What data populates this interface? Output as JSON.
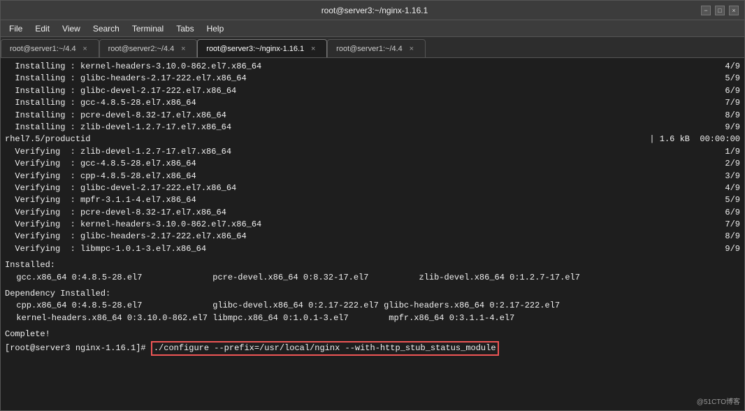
{
  "window": {
    "title": "root@server3:~/nginx-1.16.1",
    "controls": {
      "minimize": "−",
      "maximize": "□",
      "close": "×"
    }
  },
  "menubar": {
    "items": [
      "File",
      "Edit",
      "View",
      "Search",
      "Terminal",
      "Tabs",
      "Help"
    ]
  },
  "tabs": [
    {
      "id": "tab1",
      "label": "root@server1:~/4.4",
      "active": false
    },
    {
      "id": "tab2",
      "label": "root@server2:~/4.4",
      "active": false
    },
    {
      "id": "tab3",
      "label": "root@server3:~/nginx-1.16.1",
      "active": true
    },
    {
      "id": "tab4",
      "label": "root@server1:~/4.4",
      "active": false
    }
  ],
  "terminal": {
    "lines": [
      {
        "type": "install",
        "text": "  Installing : kernel-headers-3.10.0-862.el7.x86_64",
        "num": "4/9"
      },
      {
        "type": "install",
        "text": "  Installing : glibc-headers-2.17-222.el7.x86_64",
        "num": "5/9"
      },
      {
        "type": "install",
        "text": "  Installing : glibc-devel-2.17-222.el7.x86_64",
        "num": "6/9"
      },
      {
        "type": "install",
        "text": "  Installing : gcc-4.8.5-28.el7.x86_64",
        "num": "7/9"
      },
      {
        "type": "install",
        "text": "  Installing : pcre-devel-8.32-17.el7.x86_64",
        "num": "8/9"
      },
      {
        "type": "install",
        "text": "  Installing : zlib-devel-1.2.7-17.el7.x86_64",
        "num": "9/9"
      },
      {
        "type": "progress",
        "text": "rhel7.5/productid",
        "bar": "| 1.6 kB  00:00:00"
      },
      {
        "type": "verify",
        "text": "  Verifying  : zlib-devel-1.2.7-17.el7.x86_64",
        "num": "1/9"
      },
      {
        "type": "verify",
        "text": "  Verifying  : gcc-4.8.5-28.el7.x86_64",
        "num": "2/9"
      },
      {
        "type": "verify",
        "text": "  Verifying  : cpp-4.8.5-28.el7.x86_64",
        "num": "3/9"
      },
      {
        "type": "verify",
        "text": "  Verifying  : glibc-devel-2.17-222.el7.x86_64",
        "num": "4/9"
      },
      {
        "type": "verify",
        "text": "  Verifying  : mpfr-3.1.1-4.el7.x86_64",
        "num": "5/9"
      },
      {
        "type": "verify",
        "text": "  Verifying  : pcre-devel-8.32-17.el7.x86_64",
        "num": "6/9"
      },
      {
        "type": "verify",
        "text": "  Verifying  : kernel-headers-3.10.0-862.el7.x86_64",
        "num": "7/9"
      },
      {
        "type": "verify",
        "text": "  Verifying  : glibc-headers-2.17-222.el7.x86_64",
        "num": "8/9"
      },
      {
        "type": "verify",
        "text": "  Verifying  : libmpc-1.0.1-3.el7.x86_64",
        "num": "9/9"
      },
      {
        "type": "blank"
      },
      {
        "type": "section",
        "text": "Installed:"
      },
      {
        "type": "installed",
        "text": "  gcc.x86_64 0:4.8.5-28.el7              pcre-devel.x86_64 0:8.32-17.el7          zlib-devel.x86_64 0:1.2.7-17.el7"
      },
      {
        "type": "blank"
      },
      {
        "type": "section",
        "text": "Dependency Installed:"
      },
      {
        "type": "installed",
        "text": "  cpp.x86_64 0:4.8.5-28.el7              glibc-devel.x86_64 0:2.17-222.el7 glibc-headers.x86_64 0:2.17-222.el7"
      },
      {
        "type": "installed",
        "text": "  kernel-headers.x86_64 0:3.10.0-862.el7 libmpc.x86_64 0:1.0.1-3.el7        mpfr.x86_64 0:3.1.1-4.el7"
      },
      {
        "type": "blank"
      },
      {
        "type": "complete",
        "text": "Complete!"
      },
      {
        "type": "command",
        "prompt": "[root@server3 nginx-1.16.1]# ",
        "cmd": "./configure --prefix=/usr/local/nginx --with-http_stub_status_module"
      }
    ]
  },
  "watermark": "@51CTO博客"
}
